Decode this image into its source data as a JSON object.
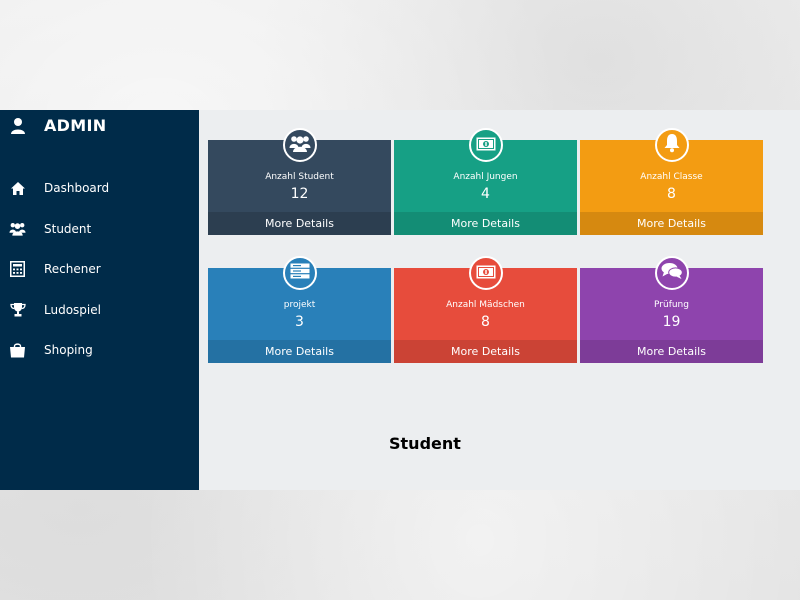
{
  "sidebar": {
    "brand": {
      "title": "ADMIN",
      "icon": "user-icon"
    },
    "items": [
      {
        "label": "Dashboard",
        "icon": "home-icon"
      },
      {
        "label": "Student",
        "icon": "users-icon"
      },
      {
        "label": "Rechener",
        "icon": "calculator-icon"
      },
      {
        "label": "Ludospiel",
        "icon": "trophy-icon"
      },
      {
        "label": "Shoping",
        "icon": "shopping-bag-icon"
      }
    ],
    "colors": {
      "background": "#002b49",
      "text": "#ffffff"
    }
  },
  "cards": [
    {
      "label": "Anzahl Student",
      "value": "12",
      "footer": "More Details",
      "icon": "users-icon",
      "color": "#34495e",
      "footer_color": "#2c3e50"
    },
    {
      "label": "Anzahl Jungen",
      "value": "4",
      "footer": "More Details",
      "icon": "money-icon",
      "color": "#16a085",
      "footer_color": "#138d75"
    },
    {
      "label": "Anzahl Classe",
      "value": "8",
      "footer": "More Details",
      "icon": "bell-icon",
      "color": "#f39c12",
      "footer_color": "#d68910"
    },
    {
      "label": "projekt",
      "value": "3",
      "footer": "More Details",
      "icon": "server-icon",
      "color": "#2980b9",
      "footer_color": "#2471a3"
    },
    {
      "label": "Anzahl Mädschen",
      "value": "8",
      "footer": "More Details",
      "icon": "money-icon",
      "color": "#e74c3c",
      "footer_color": "#cb4335"
    },
    {
      "label": "Prüfung",
      "value": "19",
      "footer": "More Details",
      "icon": "comments-icon",
      "color": "#8e44ad",
      "footer_color": "#7d3c98"
    }
  ],
  "main": {
    "section_title": "Student",
    "background": "#eceef0"
  }
}
